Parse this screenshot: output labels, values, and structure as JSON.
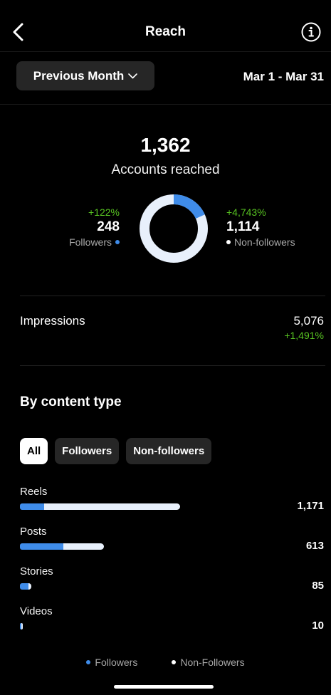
{
  "header": {
    "title": "Reach",
    "back_icon": "chevron-left-icon",
    "info_icon": "info-icon"
  },
  "filter": {
    "period_label": "Previous Month",
    "period_icon": "chevron-down-icon",
    "date_range": "Mar 1 - Mar 31"
  },
  "summary": {
    "accounts_reached": "1,362",
    "accounts_reached_label": "Accounts reached",
    "followers": {
      "change": "+122%",
      "value": "248",
      "label": "Followers"
    },
    "non_followers": {
      "change": "+4,743%",
      "value": "1,114",
      "label": "Non-followers"
    }
  },
  "impressions": {
    "label": "Impressions",
    "value": "5,076",
    "change": "+1,491%"
  },
  "content_type": {
    "title": "By content type",
    "tabs": [
      "All",
      "Followers",
      "Non-followers"
    ],
    "active_tab": "All",
    "items": [
      {
        "label": "Reels",
        "value": "1,171",
        "followers": 175,
        "non_followers": 996
      },
      {
        "label": "Posts",
        "value": "613",
        "followers": 315,
        "non_followers": 298
      },
      {
        "label": "Stories",
        "value": "85",
        "followers": 65,
        "non_followers": 20
      },
      {
        "label": "Videos",
        "value": "10",
        "followers": 5,
        "non_followers": 5
      }
    ]
  },
  "legend": {
    "followers": "Followers",
    "non_followers": "Non-Followers"
  },
  "colors": {
    "background": "#000000",
    "followers": "#3f8ce9",
    "non_followers": "#e8f0fb",
    "positive_change": "#58c322",
    "chip_bg": "#262626"
  }
}
